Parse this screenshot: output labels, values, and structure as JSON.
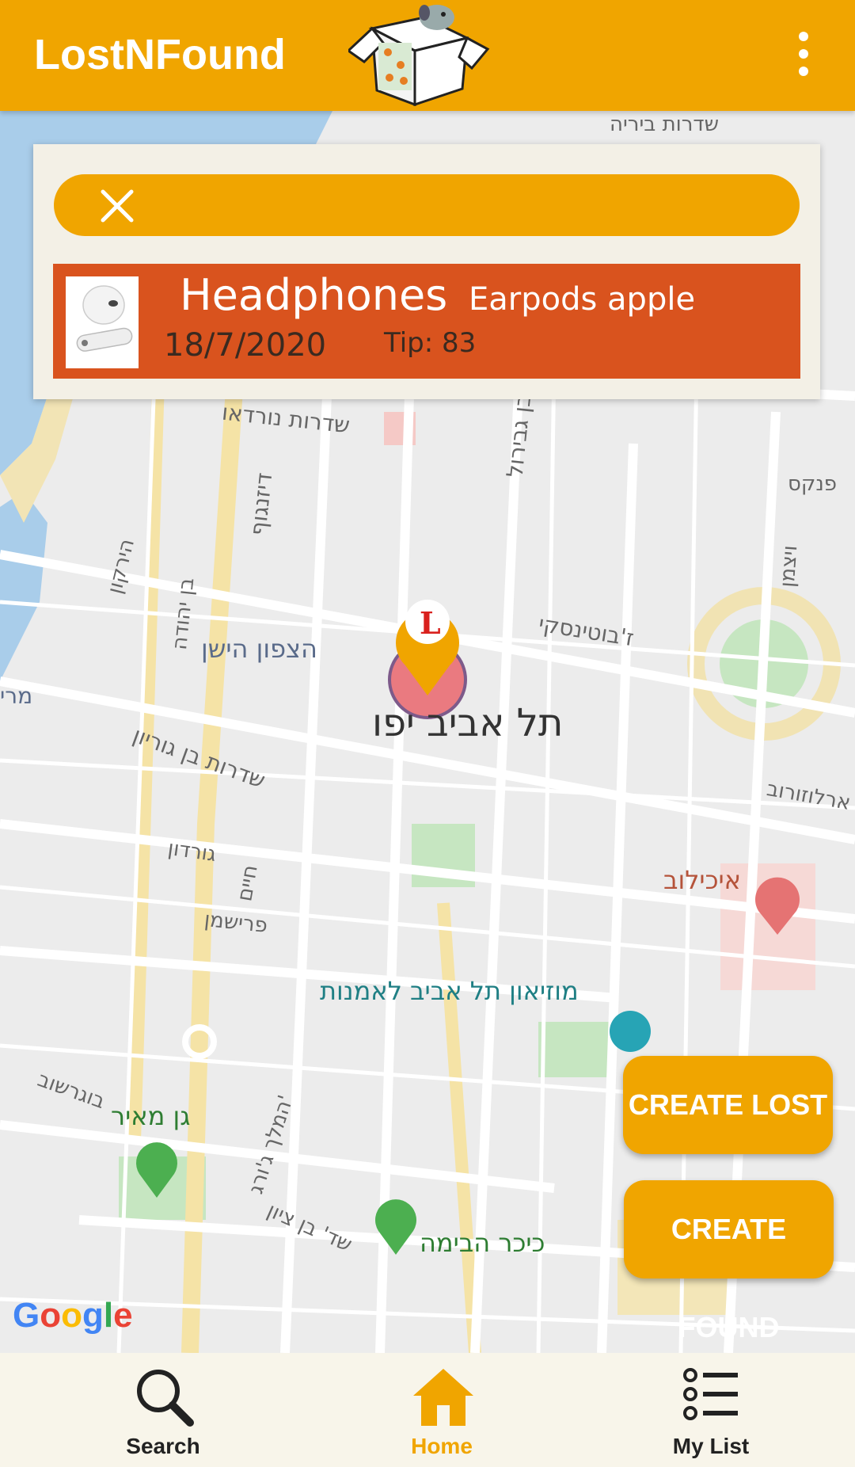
{
  "app": {
    "title": "LostNFound"
  },
  "popup": {
    "item": {
      "title": "Headphones",
      "description": "Earpods apple",
      "date": "18/7/2020",
      "tip": "Tip: 83"
    }
  },
  "map": {
    "labels": {
      "nordau": "שדרות נורדאו",
      "dizengoff": "דיזנגוף",
      "ibn_gabirol": "אבן גבירול",
      "pinkas": "פנקס",
      "weizmann": "ויצמן",
      "hayarkon": "הירקון",
      "ben_yehuda": "בן יהודה",
      "old_north": "הצפון הישן",
      "jabotinsky": "ז'בוטינסקי",
      "tel_aviv_yafo": "תל אביב יפו",
      "ben_gurion": "שדרות בן גוריון",
      "arlozorov": "ארלוזורוב",
      "gordon": "גורדון",
      "ichilov": "איכילוב",
      "hayim": "חיים",
      "frishman": "פרישמן",
      "museum": "מוזיאון תל אביב לאמנות",
      "gan_meir": "גן מאיר",
      "bograshov": "בוגרשוב",
      "king_george": "המלך ג'ורג'",
      "habima": "כיכר הבימה",
      "ben_zion": "שד' בן ציון",
      "mari": "מרי",
      "top_blvd": "שדרות ביריה"
    },
    "provider": "Google"
  },
  "actions": {
    "create_lost": "CREATE LOST",
    "create_found": "CREATE FOUND"
  },
  "nav": {
    "search": "Search",
    "home": "Home",
    "my_list": "My List"
  },
  "colors": {
    "primary": "#f0a500",
    "item_row": "#d9531e",
    "card_bg": "#f3f0e6",
    "nav_bg": "#f8f5ea"
  }
}
